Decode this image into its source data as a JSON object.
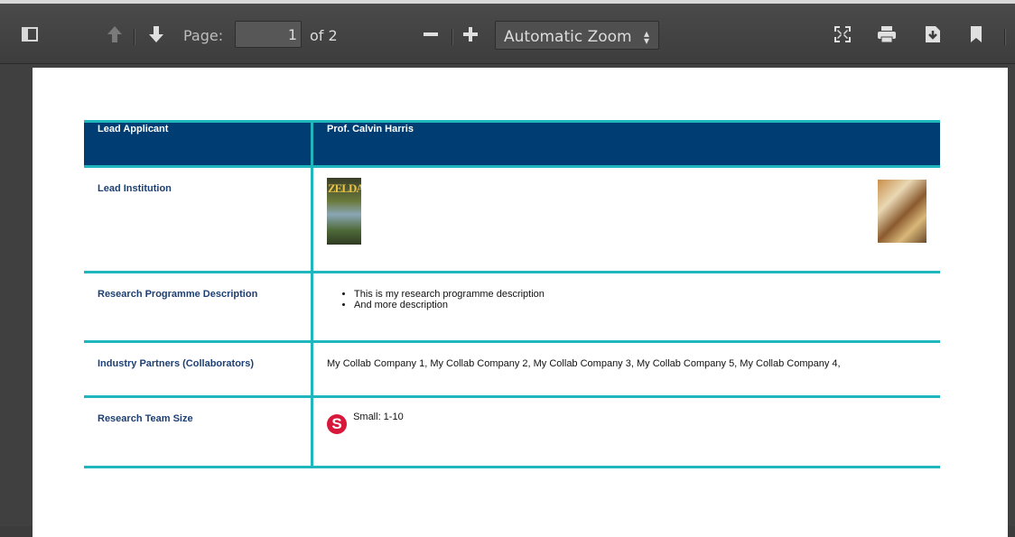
{
  "toolbar": {
    "page_label": "Page:",
    "page_value": "1",
    "page_of": "of 2",
    "zoom_value": "Automatic Zoom",
    "zoom_arrow": "↕"
  },
  "icons": [
    "sidebar-toggle-icon",
    "previous-page-icon",
    "next-page-icon",
    "zoom-out-icon",
    "zoom-in-icon",
    "presentation-mode-icon",
    "print-icon",
    "download-icon",
    "bookmark-icon"
  ],
  "table": {
    "header": {
      "label": "Lead Applicant",
      "value": "Prof. Calvin Harris"
    },
    "lead_institution_label": "Lead Institution",
    "research_programme_label": "Research Programme Description",
    "research_programme_items": [
      "This is my research programme description",
      "And more description"
    ],
    "industry_partners_label": "Industry Partners (Collaborators)",
    "industry_partners_value": "My Collab Company 1, My Collab Company 2, My Collab Company 3, My Collab Company 5, My Collab Company 4,",
    "team_size_label": "Research Team Size",
    "team_size_badge": "S",
    "team_size_value": "Small: 1-10",
    "image_left_text": "ZELDA"
  },
  "colors": {
    "header_bg": "#003d73",
    "rule": "#1fb6be",
    "label": "#1d3f73",
    "badge": "#d8183a"
  }
}
